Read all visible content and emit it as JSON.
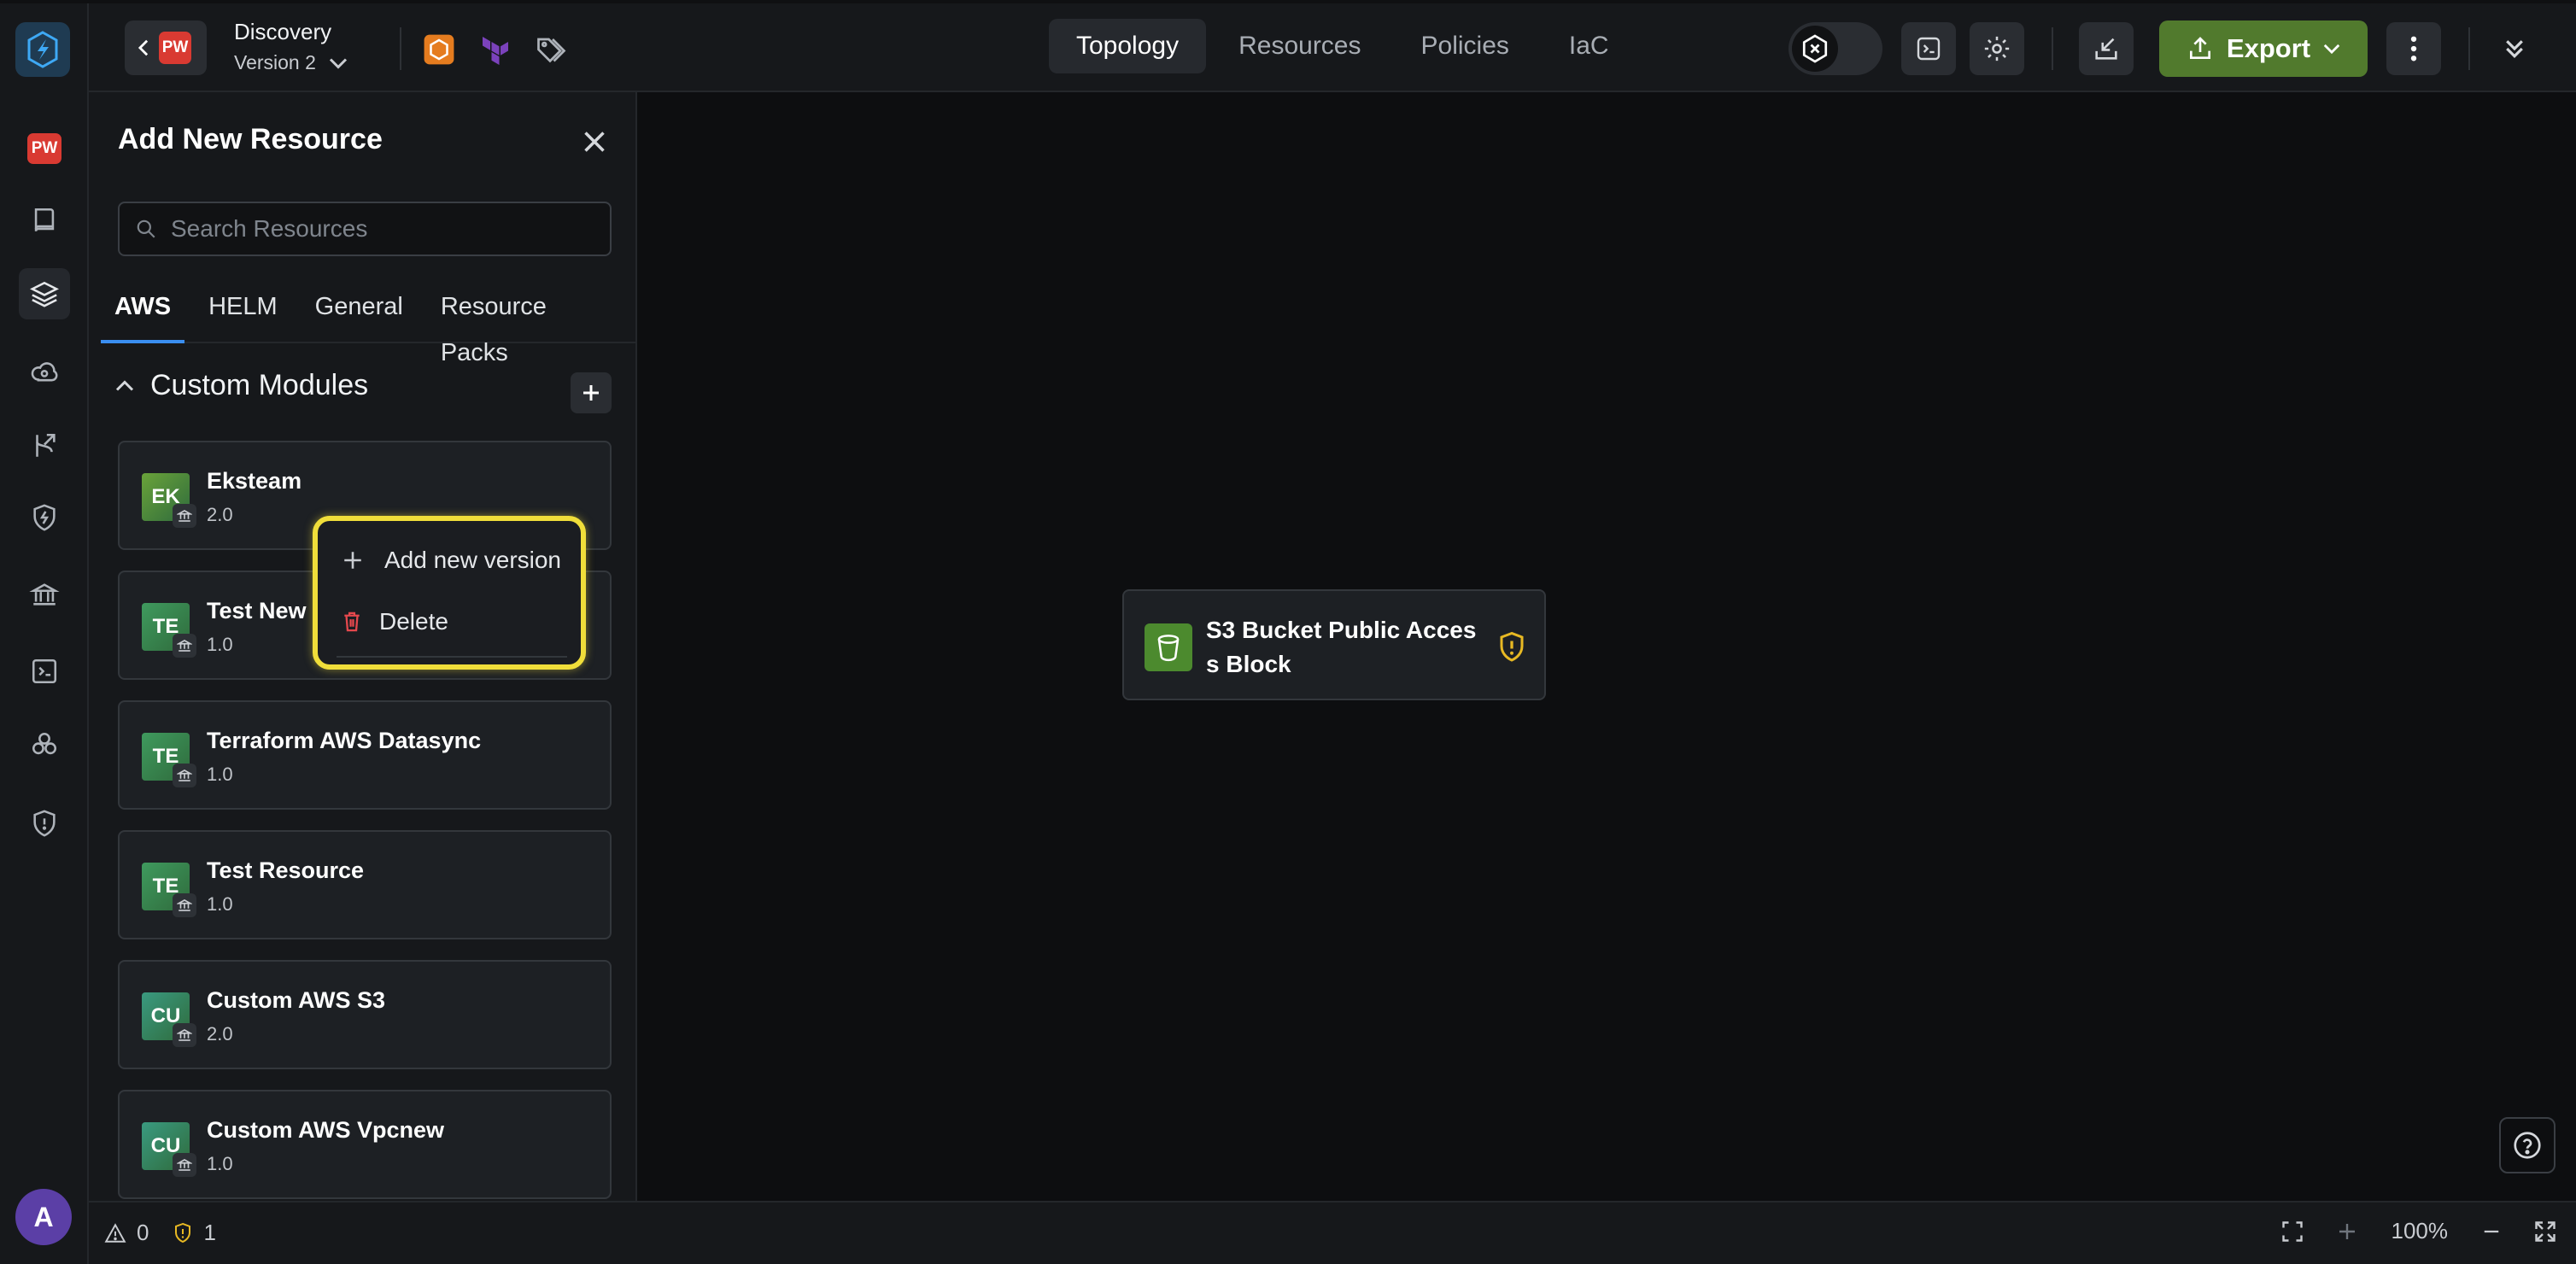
{
  "rail": {
    "workspace_badge": "PW",
    "avatar_initial": "A",
    "items": [
      "pw-workspace",
      "book-icon",
      "layers-icon",
      "cloud-search-icon",
      "branch-icon",
      "shield-bolt-icon",
      "bank-icon",
      "terminal-icon",
      "modules-icon",
      "shield-alert-icon"
    ]
  },
  "topbar": {
    "back_badge": "PW",
    "project_name": "Discovery",
    "version_label": "Version 2",
    "tabs": [
      {
        "label": "Topology",
        "active": true
      },
      {
        "label": "Resources",
        "active": false
      },
      {
        "label": "Policies",
        "active": false
      },
      {
        "label": "IaC",
        "active": false
      }
    ],
    "export_label": "Export"
  },
  "panel": {
    "title": "Add New Resource",
    "search_placeholder": "Search Resources",
    "tabs": [
      {
        "label": "AWS",
        "active": true
      },
      {
        "label": "HELM",
        "active": false
      },
      {
        "label": "General",
        "active": false
      },
      {
        "label": "Resource Packs",
        "active": false
      }
    ],
    "section_title": "Custom Modules",
    "modules": [
      {
        "abbr": "EK",
        "name": "Eksteam",
        "version": "2.0",
        "color": "#6aa33a"
      },
      {
        "abbr": "TE",
        "name": "Test New",
        "version": "1.0",
        "color": "#3f9a5e"
      },
      {
        "abbr": "TE",
        "name": "Terraform AWS Datasync",
        "version": "1.0",
        "color": "#3f9a5e"
      },
      {
        "abbr": "TE",
        "name": "Test Resource",
        "version": "1.0",
        "color": "#3f9a5e"
      },
      {
        "abbr": "CU",
        "name": "Custom AWS S3",
        "version": "2.0",
        "color": "#3a9a80"
      },
      {
        "abbr": "CU",
        "name": "Custom AWS Vpcnew",
        "version": "1.0",
        "color": "#3a9a80"
      }
    ]
  },
  "context_menu": {
    "add_version": "Add new version",
    "delete": "Delete"
  },
  "canvas": {
    "node_title": "S3 Bucket Public Access Block"
  },
  "status": {
    "errors": "0",
    "warnings": "1",
    "zoom": "100%"
  },
  "colors": {
    "accent_green": "#517a2d",
    "highlight_yellow": "#f0de3a",
    "tab_underline": "#3a8ef0",
    "warning": "#e8b923"
  }
}
